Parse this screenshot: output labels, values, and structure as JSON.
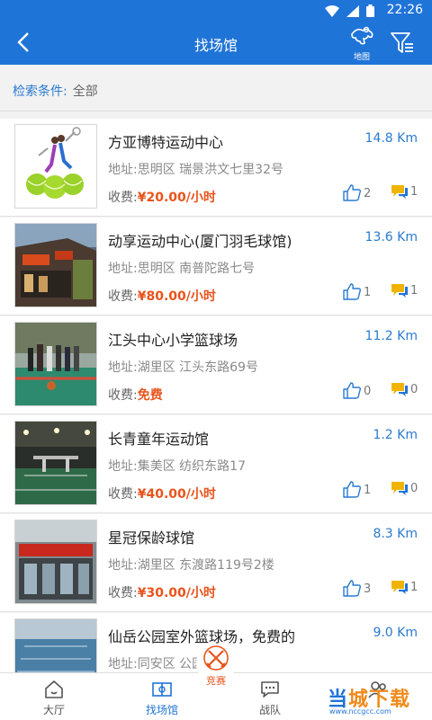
{
  "status_bar": {
    "time": "22:26"
  },
  "header": {
    "title": "找场馆",
    "map_label": "地图"
  },
  "criteria": {
    "label": "检索条件:",
    "value": "全部"
  },
  "venues": [
    {
      "name": "方亚博特运动中心",
      "distance": "14.8 Km",
      "address": "地址:思明区 瑞景洪文七里32号",
      "fee_label": "收费:",
      "price": "¥20.00/小时",
      "likes": "2",
      "comments": "1"
    },
    {
      "name": "动享运动中心(厦门羽毛球馆)",
      "distance": "13.6 Km",
      "address": "地址:思明区 南普陀路七号",
      "fee_label": "收费:",
      "price": "¥80.00/小时",
      "likes": "1",
      "comments": "1"
    },
    {
      "name": "江头中心小学篮球场",
      "distance": "11.2 Km",
      "address": "地址:湖里区 江头东路69号",
      "fee_label": "收费:",
      "price": "免费",
      "likes": "0",
      "comments": "0"
    },
    {
      "name": "长青童年运动馆",
      "distance": "1.2 Km",
      "address": "地址:集美区 纺织东路17",
      "fee_label": "收费:",
      "price": "¥40.00/小时",
      "likes": "1",
      "comments": "0"
    },
    {
      "name": "星冠保龄球馆",
      "distance": "8.3 Km",
      "address": "地址:湖里区 东渡路119号2楼",
      "fee_label": "收费:",
      "price": "¥30.00/小时",
      "likes": "3",
      "comments": "1"
    },
    {
      "name": "仙岳公园室外篮球场，免费的",
      "distance": "9.0 Km",
      "address": "地址:同安区 公园",
      "fee_label": "",
      "price": "",
      "likes": "",
      "comments": ""
    }
  ],
  "tabs": [
    {
      "label": "大厅",
      "icon": "home-icon"
    },
    {
      "label": "找场馆",
      "icon": "court-icon"
    },
    {
      "label": "竞赛",
      "icon": "swords-icon"
    },
    {
      "label": "战队",
      "icon": "chat-icon"
    },
    {
      "label": "",
      "icon": "people-icon"
    }
  ],
  "watermark": {
    "part1": "当",
    "part2": "城下载",
    "url": "www.nccgcc.com"
  },
  "colors": {
    "primary": "#1f74d8",
    "price": "#e8541c",
    "comment_icon": "#f0b400"
  }
}
